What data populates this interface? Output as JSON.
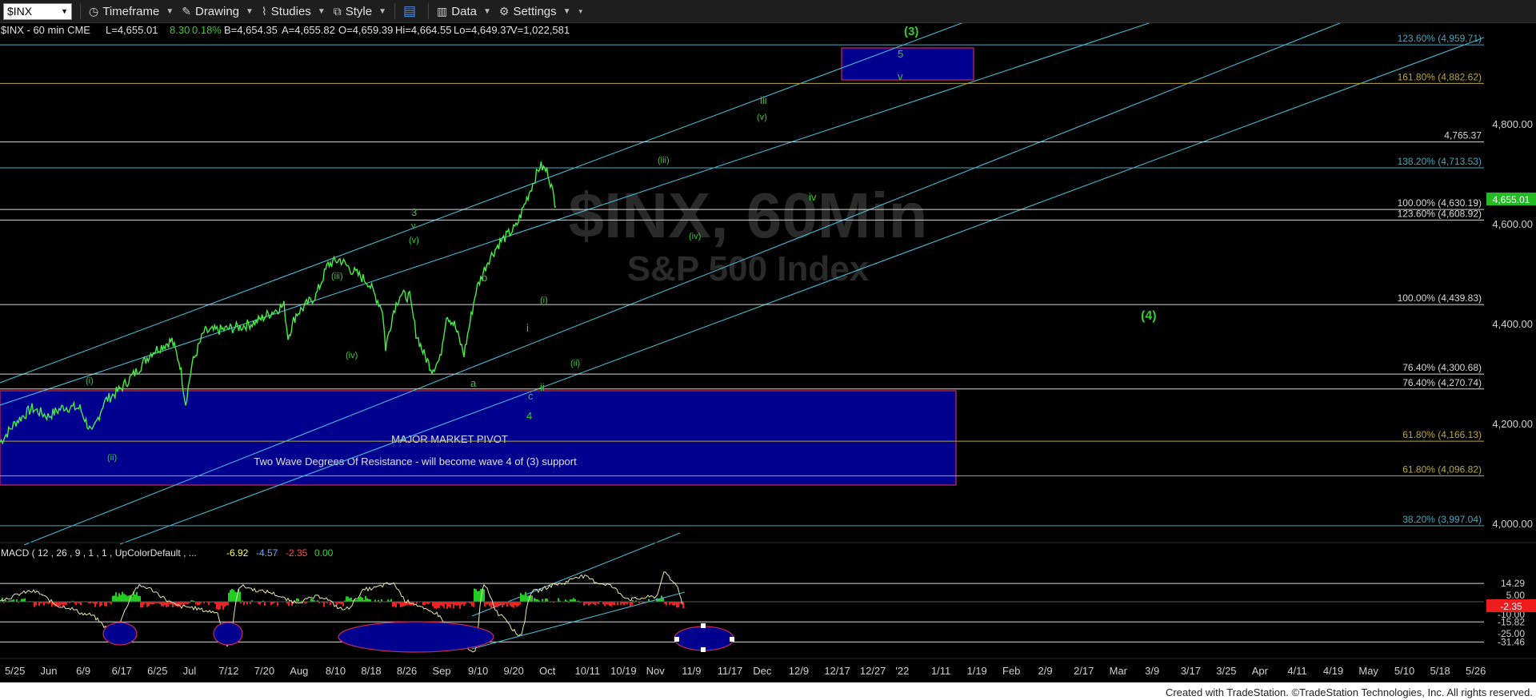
{
  "toolbar": {
    "symbol": "$INX",
    "timeframe": "Timeframe",
    "drawing": "Drawing",
    "studies": "Studies",
    "style": "Style",
    "data": "Data",
    "settings": "Settings"
  },
  "chart_data": {
    "type": "line",
    "header": "$INX - 60 min  CME",
    "quote": {
      "L": "L=4,655.01",
      "chg": "8.30",
      "pct": "0.18%",
      "B": "B=4,654.35",
      "A": "A=4,655.82",
      "O": "O=4,659.39",
      "Hi": "Hi=4,664.55",
      "Lo": "Lo=4,649.37",
      "V": "V=1,022,581"
    },
    "watermark": {
      "line1": "$INX, 60Min",
      "line2": "S&P 500 Index"
    },
    "last_price": "4,655.01",
    "ylim": [
      3960,
      5000
    ],
    "y_ticks": [
      "4,000.00",
      "4,200.00",
      "4,400.00",
      "4,600.00",
      "4,800.00"
    ],
    "y_tick_values": [
      4000,
      4200,
      4400,
      4600,
      4800
    ],
    "x_labels": [
      "5/25",
      "Jun",
      "6/9",
      "6/17",
      "6/25",
      "Jul",
      "7/12",
      "7/20",
      "Aug",
      "8/10",
      "8/18",
      "8/26",
      "Sep",
      "9/10",
      "9/20",
      "Oct",
      "10/11",
      "10/19",
      "Nov",
      "11/9",
      "11/17",
      "Dec",
      "12/9",
      "12/17",
      "12/27",
      "'22",
      "1/11",
      "1/19",
      "Feb",
      "2/9",
      "2/17",
      "Mar",
      "3/9",
      "3/17",
      "3/25",
      "Apr",
      "4/11",
      "4/19",
      "May",
      "5/10",
      "5/18",
      "5/26"
    ],
    "price_path": [
      [
        0,
        4164
      ],
      [
        20,
        4205
      ],
      [
        40,
        4232
      ],
      [
        60,
        4216
      ],
      [
        80,
        4235
      ],
      [
        100,
        4232
      ],
      [
        115,
        4180
      ],
      [
        130,
        4245
      ],
      [
        150,
        4270
      ],
      [
        170,
        4305
      ],
      [
        190,
        4345
      ],
      [
        215,
        4368
      ],
      [
        225,
        4320
      ],
      [
        232,
        4242
      ],
      [
        240,
        4320
      ],
      [
        255,
        4385
      ],
      [
        280,
        4390
      ],
      [
        300,
        4395
      ],
      [
        320,
        4405
      ],
      [
        340,
        4425
      ],
      [
        355,
        4438
      ],
      [
        360,
        4375
      ],
      [
        370,
        4420
      ],
      [
        395,
        4458
      ],
      [
        410,
        4520
      ],
      [
        425,
        4530
      ],
      [
        440,
        4508
      ],
      [
        460,
        4485
      ],
      [
        478,
        4430
      ],
      [
        482,
        4353
      ],
      [
        492,
        4428
      ],
      [
        500,
        4460
      ],
      [
        512,
        4455
      ],
      [
        520,
        4383
      ],
      [
        530,
        4340
      ],
      [
        540,
        4310
      ],
      [
        550,
        4330
      ],
      [
        558,
        4420
      ],
      [
        568,
        4400
      ],
      [
        580,
        4340
      ],
      [
        595,
        4468
      ],
      [
        610,
        4528
      ],
      [
        625,
        4565
      ],
      [
        645,
        4595
      ],
      [
        660,
        4658
      ],
      [
        675,
        4718
      ],
      [
        685,
        4705
      ],
      [
        695,
        4636
      ]
    ],
    "fib_levels": [
      {
        "label": "123.60% (4,959.71)",
        "value": 4959.71,
        "color": "#4ca6bf"
      },
      {
        "label": "161.80% (4,882.62)",
        "value": 4882.62,
        "color": "#b8a83c"
      },
      {
        "label": "4,765.37",
        "value": 4765.37,
        "color": "#d8d8d8"
      },
      {
        "label": "138.20% (4,713.53)",
        "value": 4713.53,
        "color": "#4ca6bf"
      },
      {
        "label": "100.00% (4,630.19)",
        "value": 4630.19,
        "color": "#d8d8d8"
      },
      {
        "label": "123.60% (4,608.92)",
        "value": 4608.92,
        "color": "#d8d8d8"
      },
      {
        "label": "100.00% (4,439.83)",
        "value": 4439.83,
        "color": "#d8d8d8"
      },
      {
        "label": "76.40% (4,300.68)",
        "value": 4300.68,
        "color": "#d8d8d8"
      },
      {
        "label": "76.40% (4,270.74)",
        "value": 4270.74,
        "color": "#d8d8d8"
      },
      {
        "label": "61.80% (4,166.13)",
        "value": 4166.13,
        "color": "#b8a83c"
      },
      {
        "label": "61.80% (4,096.82)",
        "value": 4096.82,
        "color": "#b8a83c"
      },
      {
        "label": "38.20% (3,997.04)",
        "value": 3997.04,
        "color": "#4ca6bf"
      }
    ],
    "annotations": [
      {
        "text": "MAJOR MARKET PIVOT",
        "color": "#e0e0e0"
      },
      {
        "text": "Two Wave Degrees Of Resistance - will become wave 4 of (3) support",
        "color": "#e0e0e0"
      }
    ],
    "wave_labels": [
      "(3)",
      "5",
      "v",
      "iii",
      "(v)",
      "iv",
      "(iii)",
      "(iv)",
      "3",
      "v",
      "(v)",
      "(iii)",
      "(iv)",
      "b",
      "a",
      "c",
      "ii",
      "4",
      "i",
      "(i)",
      "(ii)",
      "(i)",
      "(ii)",
      "(4)"
    ],
    "macd": {
      "title": "MACD ( 12 , 26 , 9 , 1 , 1 , UpColorDefault , ...",
      "values": [
        "-6.92",
        "-4.57",
        "-2.35",
        "0.00"
      ],
      "colors": [
        "#ffff66",
        "#6fa8ff",
        "#ff4d4d",
        "#33cc33"
      ],
      "ylim": [
        -36,
        22
      ],
      "y_ticks": [
        "14.29",
        "5.00",
        "-10.00",
        "-15.82",
        "-25.00",
        "-31.46"
      ],
      "y_tick_values": [
        14.29,
        5,
        -10,
        -15.82,
        -25,
        -31.46
      ],
      "current_label": "-2.35"
    },
    "footer": "Created with TradeStation. ©TradeStation Technologies, Inc. All rights reserved."
  }
}
